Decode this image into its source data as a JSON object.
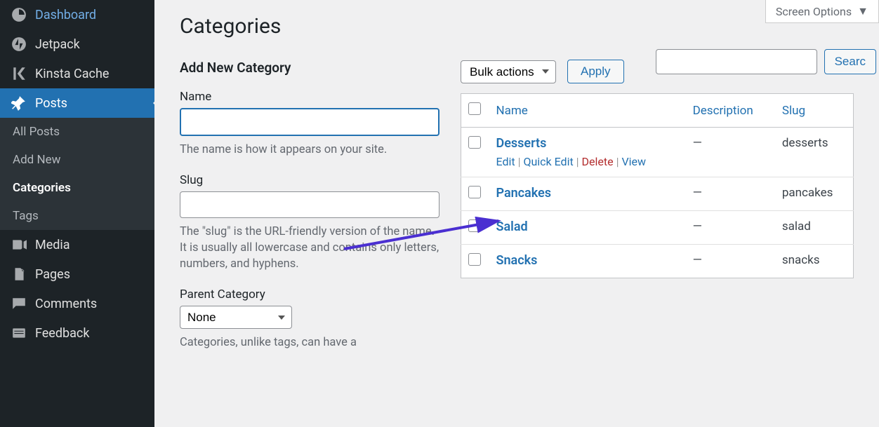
{
  "sidebar": {
    "items": [
      {
        "label": "Dashboard",
        "icon": "dashboard"
      },
      {
        "label": "Jetpack",
        "icon": "jetpack"
      },
      {
        "label": "Kinsta Cache",
        "icon": "kinsta"
      },
      {
        "label": "Posts",
        "icon": "pin",
        "active": true
      },
      {
        "label": "Media",
        "icon": "media"
      },
      {
        "label": "Pages",
        "icon": "pages"
      },
      {
        "label": "Comments",
        "icon": "comments"
      },
      {
        "label": "Feedback",
        "icon": "feedback"
      }
    ],
    "submenu": [
      {
        "label": "All Posts"
      },
      {
        "label": "Add New"
      },
      {
        "label": "Categories",
        "current": true
      },
      {
        "label": "Tags"
      }
    ]
  },
  "screen_options_label": "Screen Options",
  "page_title": "Categories",
  "search": {
    "button": "Searc"
  },
  "form": {
    "heading": "Add New Category",
    "name": {
      "label": "Name",
      "desc": "The name is how it appears on your site."
    },
    "slug": {
      "label": "Slug",
      "desc": "The \"slug\" is the URL-friendly version of the name. It is usually all lowercase and contains only letters, numbers, and hyphens."
    },
    "parent": {
      "label": "Parent Category",
      "selected": "None",
      "desc": "Categories, unlike tags, can have a"
    }
  },
  "bulk": {
    "label": "Bulk actions",
    "apply": "Apply"
  },
  "table": {
    "headers": {
      "name": "Name",
      "description": "Description",
      "slug": "Slug"
    },
    "rows": [
      {
        "name": "Desserts",
        "description": "—",
        "slug": "desserts",
        "actions": {
          "edit": "Edit",
          "quick_edit": "Quick Edit",
          "delete": "Delete",
          "view": "View"
        },
        "show_actions": true
      },
      {
        "name": "Pancakes",
        "description": "—",
        "slug": "pancakes",
        "show_actions": false
      },
      {
        "name": "Salad",
        "description": "—",
        "slug": "salad",
        "show_actions": false
      },
      {
        "name": "Snacks",
        "description": "—",
        "slug": "snacks",
        "show_actions": false
      }
    ]
  }
}
